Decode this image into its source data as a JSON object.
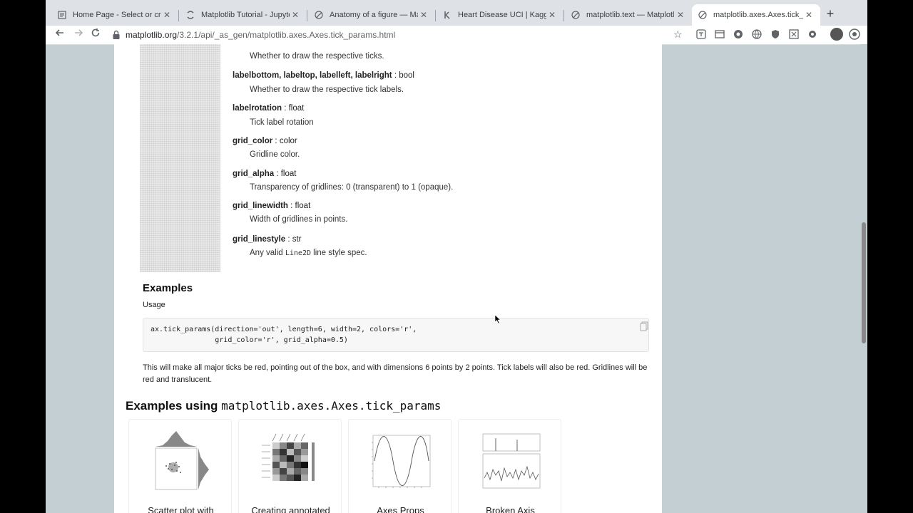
{
  "tabs": [
    {
      "title": "Home Page - Select or crea",
      "active": false
    },
    {
      "title": "Matplotlib Tutorial - Jupyte",
      "active": false
    },
    {
      "title": "Anatomy of a figure — Matp",
      "active": false
    },
    {
      "title": "Heart Disease UCI | Kaggle",
      "active": false
    },
    {
      "title": "matplotlib.text — Matplotlib",
      "active": false
    },
    {
      "title": "matplotlib.axes.Axes.tick_pa",
      "active": true
    }
  ],
  "toolbar": {
    "url_host": "matplotlib.org",
    "url_path": "/3.2.1/api/_as_gen/matplotlib.axes.Axes.tick_params.html"
  },
  "params": [
    {
      "name": "labelbottom, labeltop, labelleft, labelright",
      "type": " : bool",
      "desc": "Whether to draw the respective tick labels."
    },
    {
      "name": "labelrotation",
      "type": " : float",
      "desc": "Tick label rotation"
    },
    {
      "name": "grid_color",
      "type": " : color",
      "desc": "Gridline color."
    },
    {
      "name": "grid_alpha",
      "type": " : float",
      "desc": "Transparency of gridlines: 0 (transparent) to 1 (opaque)."
    },
    {
      "name": "grid_linewidth",
      "type": " : float",
      "desc": "Width of gridlines in points."
    },
    {
      "name": "grid_linestyle",
      "type": " : str",
      "desc_prefix": "Any valid ",
      "desc_code": "Line2D",
      "desc_suffix": " line style spec."
    }
  ],
  "top_desc": "Whether to draw the respective ticks.",
  "examples": {
    "heading": "Examples",
    "usage": "Usage",
    "code_line1": "ax.tick_params(direction='out', length=6, width=2, colors='r',",
    "code_line2": "               grid_color='r', grid_alpha=0.5)",
    "paragraph": "This will make all major ticks be red, pointing out of the box, and with dimensions 6 points by 2 points. Tick labels will also be red. Gridlines will be red and translucent."
  },
  "using": {
    "heading_prefix": "Examples using ",
    "heading_code": "matplotlib.axes.Axes.tick_params"
  },
  "gallery": [
    {
      "label": "Scatter plot with"
    },
    {
      "label": "Creating annotated"
    },
    {
      "label": "Axes Props"
    },
    {
      "label": "Broken Axis"
    }
  ]
}
